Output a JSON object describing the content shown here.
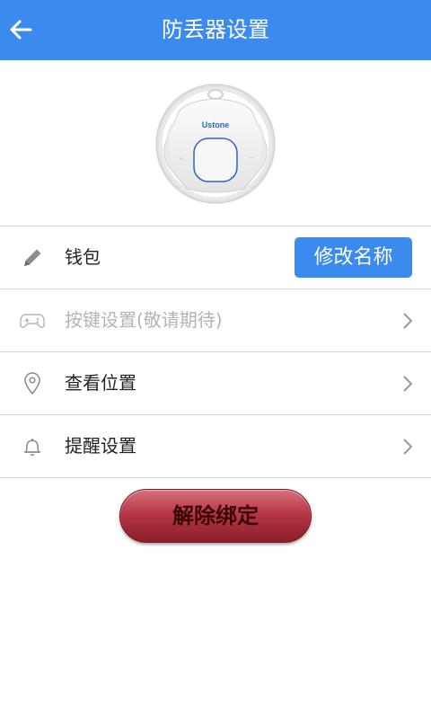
{
  "header": {
    "title": "防丢器设置",
    "back_icon": "arrow-left-icon"
  },
  "device": {
    "brand": "Ustone"
  },
  "rows": [
    {
      "icon": "pencil-icon",
      "label": "钱包",
      "action": "修改名称"
    },
    {
      "icon": "gamepad-icon",
      "label": "按键设置(敬请期待)",
      "disabled": true
    },
    {
      "icon": "location-pin-icon",
      "label": "查看位置"
    },
    {
      "icon": "bell-icon",
      "label": "提醒设置"
    }
  ],
  "unbind_button": {
    "label": "解除绑定"
  },
  "colors": {
    "accent": "#3b8bef",
    "danger": "#a52a38"
  }
}
